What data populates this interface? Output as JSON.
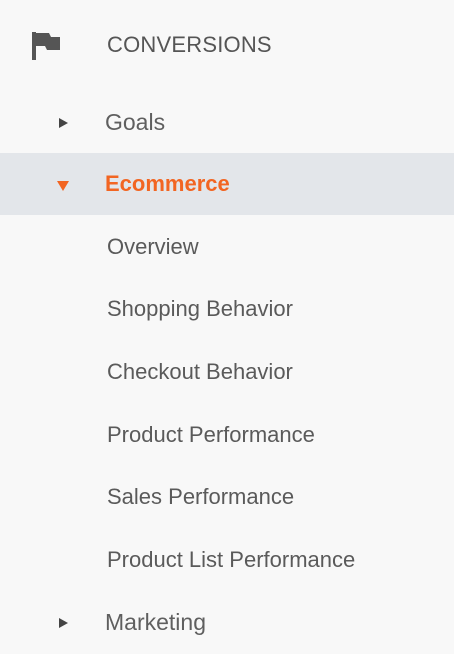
{
  "section": {
    "icon": "flag-icon",
    "title": "CONVERSIONS"
  },
  "nav": {
    "goals": {
      "label": "Goals",
      "icon": "caret-right-icon",
      "expanded": false
    },
    "ecommerce": {
      "label": "Ecommerce",
      "icon": "caret-down-icon",
      "expanded": true,
      "active": true,
      "subitems": [
        "Overview",
        "Shopping Behavior",
        "Checkout Behavior",
        "Product Performance",
        "Sales Performance",
        "Product List Performance"
      ]
    },
    "marketing": {
      "label": "Marketing",
      "icon": "caret-right-icon",
      "expanded": false
    }
  },
  "colors": {
    "accent": "#f26522",
    "active_row_bg": "#e3e6ea",
    "background": "#f8f8f8",
    "text": "#5a5a5a"
  }
}
